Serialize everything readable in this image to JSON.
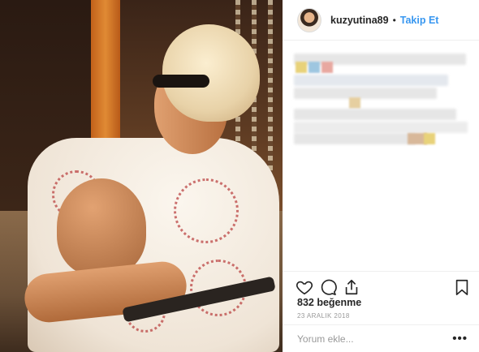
{
  "post": {
    "author": {
      "username": "kuzyutina89",
      "separator": "•",
      "follow_label": "Takip Et"
    },
    "likes_text": "832 beğenme",
    "date_text": "23 ARALIK 2018",
    "comment": {
      "placeholder": "Yorum ekle...",
      "more_label": "•••"
    },
    "icons": {
      "like": "heart-icon",
      "comment": "comment-icon",
      "share": "share-icon",
      "save": "bookmark-icon",
      "more": "more-options-icon"
    },
    "colors": {
      "follow": "#3897f0",
      "text": "#262626",
      "muted": "#999999",
      "divider": "#efefef"
    }
  }
}
